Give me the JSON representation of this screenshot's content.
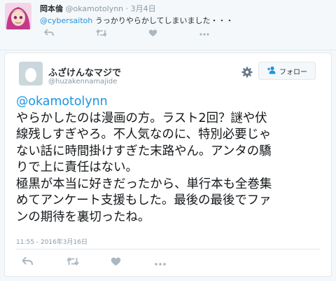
{
  "reply": {
    "author_name": "岡本倫",
    "screen_name": "@okamotolynn",
    "separator": "·",
    "date": "3月4日",
    "mention": "@cybersaitoh",
    "text": "うっかりやらかしてしまいました・・・",
    "icons": [
      "reply-icon",
      "retweet-icon",
      "like-icon",
      "more-icon"
    ]
  },
  "tweet": {
    "author_name": "ふざけんなマジで",
    "screen_name": "@huzakennamajide",
    "follow_label": "フォロー",
    "mention": "@okamotolynn",
    "lines": [
      "やらかしたのは漫画の方。ラスト2回？謎や伏",
      "線残しすぎやろ。不人気なのに、特別必要じゃ",
      "ない話に時間掛けすぎた末路やん。アンタの驕",
      "りで上に責任はない。",
      "極黒が本当に好きだったから、単行本も全巻集",
      "めてアンケート支援もした。最後の最後でファ",
      "ンの期待を裏切ったね。"
    ],
    "timestamp": "11:55 - 2016年3月16日",
    "icons": [
      "gear-icon",
      "follow-user-icon",
      "reply-icon",
      "retweet-icon",
      "like-icon",
      "more-icon"
    ]
  },
  "colors": {
    "link": "#1b95e0",
    "muted": "#8899a6",
    "icon_gray": "#aab8c2",
    "background": "#f5f8fa"
  }
}
